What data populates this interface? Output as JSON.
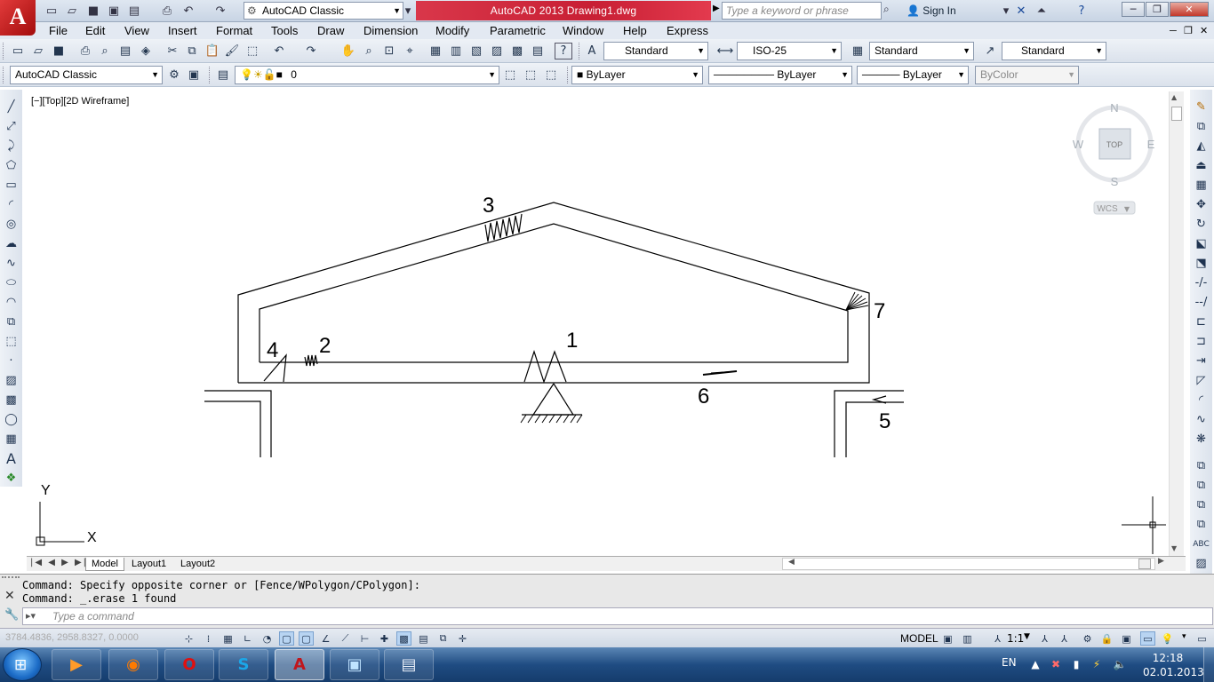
{
  "titlebar": {
    "app_logo": "A",
    "workspace": "AutoCAD Classic",
    "title": "AutoCAD 2013    Drawing1.dwg",
    "search_placeholder": "Type a keyword or phrase",
    "sign_in": "Sign In"
  },
  "menubar": [
    "File",
    "Edit",
    "View",
    "Insert",
    "Format",
    "Tools",
    "Draw",
    "Dimension",
    "Modify",
    "Parametric",
    "Window",
    "Help",
    "Express"
  ],
  "styles_toolbar": {
    "text_style": "Standard",
    "dim_style": "ISO-25",
    "table_style": "Standard",
    "mleader_style": "Standard"
  },
  "layers_toolbar": {
    "workspace": "AutoCAD Classic",
    "layer": "0",
    "color": "ByLayer",
    "linetype": "ByLayer",
    "lineweight": "ByLayer",
    "plotstyle": "ByColor"
  },
  "viewport_label": "[−][Top][2D Wireframe]",
  "viewcube": {
    "n": "N",
    "s": "S",
    "e": "E",
    "w": "W",
    "top": "TOP",
    "wcs": "WCS"
  },
  "drawing_labels": {
    "l1": "1",
    "l2": "2",
    "l3": "3",
    "l4": "4",
    "l5": "5",
    "l6": "6",
    "l7": "7"
  },
  "ucs": {
    "x": "X",
    "y": "Y"
  },
  "tabs": [
    "Model",
    "Layout1",
    "Layout2"
  ],
  "command_history": [
    "Command: Specify opposite corner or [Fence/WPolygon/CPolygon]:",
    "Command: _.erase 1 found"
  ],
  "command_placeholder": "Type a command",
  "status": {
    "coords": "3784.4836, 2958.8327, 0.0000",
    "space": "MODEL",
    "annotation_scale": "1:1"
  },
  "taskbar": {
    "lang": "EN",
    "time": "12:18",
    "date": "02.01.2013"
  },
  "colors": {
    "title_accent": "#c81f34",
    "autocad_red": "#c0161c"
  }
}
